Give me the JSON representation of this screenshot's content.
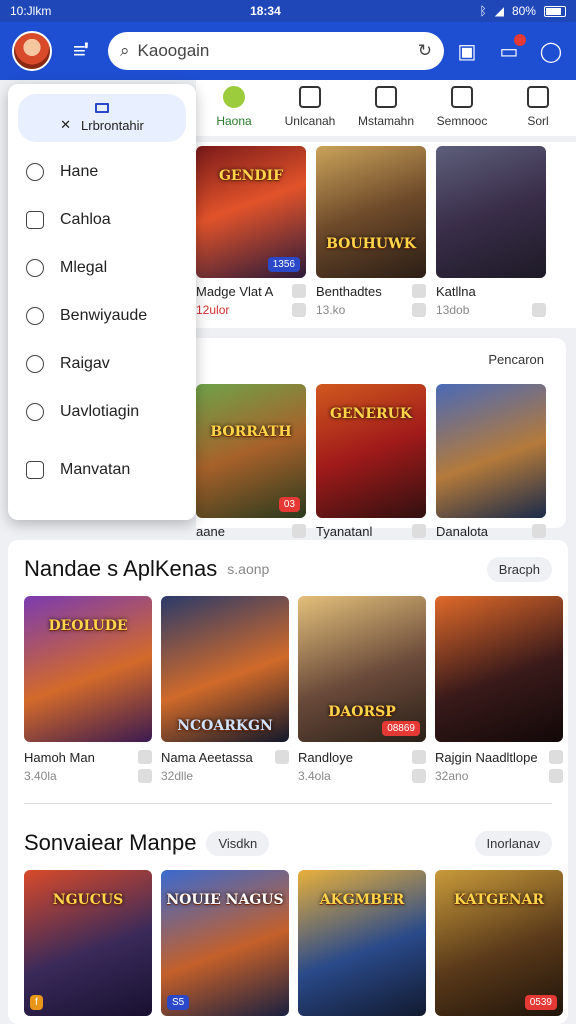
{
  "status_bar": {
    "left": "10:Jlkm",
    "time": "18:34",
    "battery": "80%"
  },
  "app_bar": {
    "search_placeholder": "Kaoogain"
  },
  "categories": [
    {
      "label": "Haona",
      "active": true
    },
    {
      "label": "Unlcanah",
      "active": false
    },
    {
      "label": "Mstamahn",
      "active": false
    },
    {
      "label": "Semnooc",
      "active": false
    },
    {
      "label": "Sorl",
      "active": false
    }
  ],
  "row1": [
    {
      "name": "Madge Vlat A",
      "sub": "12ulor",
      "art": "GENDIF",
      "tag": "1356",
      "tag_color": "blue"
    },
    {
      "name": "Benthadtes",
      "sub": "13.ko",
      "art": "BOUHUWK",
      "tag": "",
      "tag_color": ""
    },
    {
      "name": "Katllna",
      "sub": "13dob",
      "art": "",
      "tag": "",
      "tag_color": ""
    }
  ],
  "row2": {
    "label": "Pencaron",
    "cards": [
      {
        "name": "aane",
        "art": "BORRATH",
        "tag": "03"
      },
      {
        "name": "Tyanatanl",
        "art": "GENERUK",
        "tag": ""
      },
      {
        "name": "Danalota",
        "art": "",
        "tag": ""
      }
    ]
  },
  "drawer": {
    "header": "Lrbrontahir",
    "items": [
      "Hane",
      "Cahloa",
      "Mlegal",
      "Benwiyaude",
      "Raigav",
      "Uavlotiagin",
      "Manvatan"
    ]
  },
  "section1": {
    "title": "Nandae s AplKenas",
    "subtitle": "s.aonp",
    "action": "Bracph",
    "cards": [
      {
        "name": "Hamoh Man",
        "sub": "3.40la",
        "art": "DEOLUDE",
        "tag": ""
      },
      {
        "name": "Nama Aeetassa",
        "sub": "32dlle",
        "art": "NCOARKGN",
        "tag": ""
      },
      {
        "name": "Randloye",
        "sub": "3.4ola",
        "art": "DAORSP",
        "tag": "08869"
      },
      {
        "name": "Rajgin Naadltlope",
        "sub": "32ano",
        "art": "",
        "tag": ""
      }
    ]
  },
  "section2": {
    "title": "Sonvaiear Manpe",
    "chip": "Visdkn",
    "action": "Inorlanav",
    "cards": [
      {
        "art": "NGUCUS",
        "tag": "f"
      },
      {
        "art": "NOUIE NAGUS",
        "tag": "S5"
      },
      {
        "art": "AKGMBER",
        "tag": ""
      },
      {
        "art": "KATGENAR",
        "tag": "0539"
      }
    ]
  }
}
